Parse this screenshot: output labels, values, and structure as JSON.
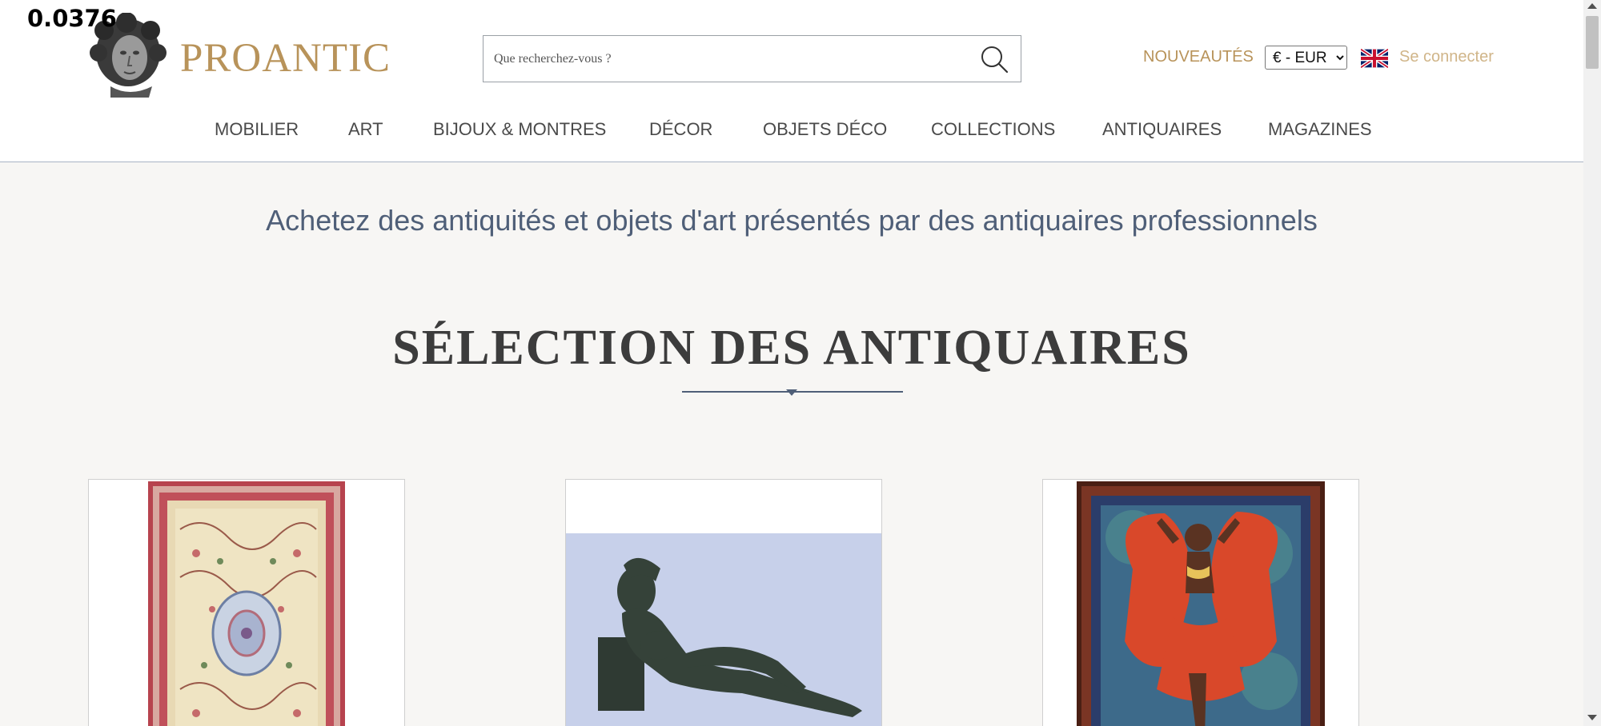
{
  "debug": {
    "value": "0.0376"
  },
  "header": {
    "brand": "PROANTIC",
    "logo_icon": "classical-bust-logo",
    "search": {
      "placeholder": "Que recherchez-vous ?",
      "value": "",
      "icon": "search-icon"
    },
    "nouveautes": "NOUVEAUTÉS",
    "currency": {
      "selected": "€ - EUR"
    },
    "language_flag_icon": "uk-flag-icon",
    "login": "Se connecter"
  },
  "nav": {
    "items": [
      {
        "label": "MOBILIER"
      },
      {
        "label": "ART"
      },
      {
        "label": "BIJOUX & MONTRES"
      },
      {
        "label": "DÉCOR"
      },
      {
        "label": "OBJETS DÉCO"
      },
      {
        "label": "COLLECTIONS"
      },
      {
        "label": "ANTIQUAIRES"
      },
      {
        "label": "MAGAZINES"
      }
    ]
  },
  "main": {
    "tagline": "Achetez des antiquités et objets d'art présentés par des antiquaires professionnels",
    "section_title": "SÉLECTION DES ANTIQUAIRES",
    "cards": [
      {
        "subject": "persian-rug-image"
      },
      {
        "subject": "reclining-bronze-sculpture-image"
      },
      {
        "subject": "framed-dancer-painting-image"
      }
    ]
  },
  "colors": {
    "gold": "#b8935a",
    "gold_light": "#d0b589",
    "slate": "#4f5f78",
    "background": "#f7f6f4"
  }
}
